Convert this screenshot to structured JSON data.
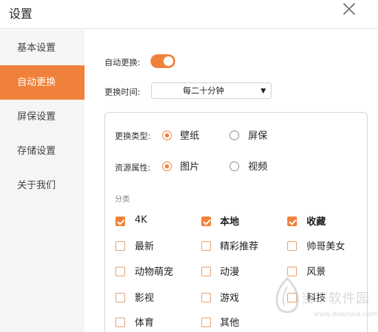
{
  "window": {
    "title": "设置",
    "close_icon": "close-icon"
  },
  "sidebar": {
    "items": [
      {
        "label": "基本设置",
        "active": false
      },
      {
        "label": "自动更换",
        "active": true
      },
      {
        "label": "屏保设置",
        "active": false
      },
      {
        "label": "存储设置",
        "active": false
      },
      {
        "label": "关于我们",
        "active": false
      }
    ]
  },
  "main": {
    "auto_change_label": "自动更换:",
    "auto_change_on": true,
    "interval_label": "更换时间:",
    "interval_value": "每二十分钟",
    "type_label": "更换类型:",
    "type_options": [
      "壁纸",
      "屏保"
    ],
    "type_selected": "壁纸",
    "resource_label": "资源属性:",
    "resource_options": [
      "图片",
      "视频"
    ],
    "resource_selected": "图片",
    "category_label": "分类",
    "categories": [
      {
        "label": "4K",
        "checked": true
      },
      {
        "label": "本地",
        "checked": true
      },
      {
        "label": "收藏",
        "checked": true
      },
      {
        "label": "最新",
        "checked": false
      },
      {
        "label": "精彩推荐",
        "checked": false
      },
      {
        "label": "帅哥美女",
        "checked": false
      },
      {
        "label": "动物萌宠",
        "checked": false
      },
      {
        "label": "动漫",
        "checked": false
      },
      {
        "label": "风景",
        "checked": false
      },
      {
        "label": "影视",
        "checked": false
      },
      {
        "label": "游戏",
        "checked": false
      },
      {
        "label": "科技",
        "checked": false
      },
      {
        "label": "体育",
        "checked": false
      },
      {
        "label": "其他",
        "checked": false
      }
    ]
  },
  "watermark": {
    "name": "当下软件园",
    "url": "www.downxia.com"
  },
  "colors": {
    "accent": "#f0813b",
    "sidebar_bg": "#f5f5f5"
  }
}
